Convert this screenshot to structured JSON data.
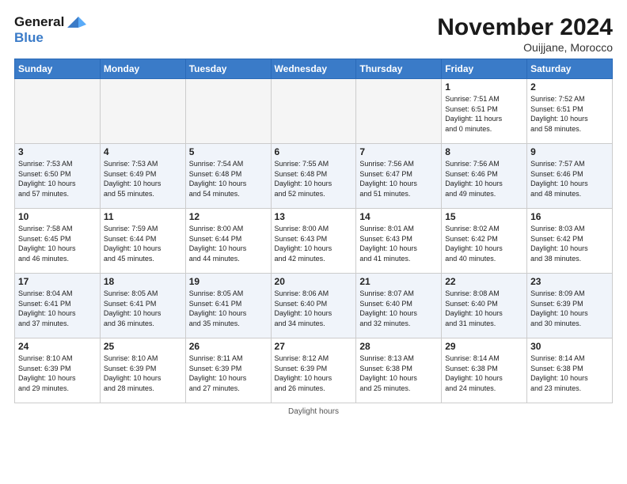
{
  "logo": {
    "line1": "General",
    "line2": "Blue"
  },
  "title": "November 2024",
  "subtitle": "Ouijjane, Morocco",
  "days_header": [
    "Sunday",
    "Monday",
    "Tuesday",
    "Wednesday",
    "Thursday",
    "Friday",
    "Saturday"
  ],
  "footer": "Daylight hours",
  "weeks": [
    [
      {
        "num": "",
        "info": ""
      },
      {
        "num": "",
        "info": ""
      },
      {
        "num": "",
        "info": ""
      },
      {
        "num": "",
        "info": ""
      },
      {
        "num": "",
        "info": ""
      },
      {
        "num": "1",
        "info": "Sunrise: 7:51 AM\nSunset: 6:51 PM\nDaylight: 11 hours\nand 0 minutes."
      },
      {
        "num": "2",
        "info": "Sunrise: 7:52 AM\nSunset: 6:51 PM\nDaylight: 10 hours\nand 58 minutes."
      }
    ],
    [
      {
        "num": "3",
        "info": "Sunrise: 7:53 AM\nSunset: 6:50 PM\nDaylight: 10 hours\nand 57 minutes."
      },
      {
        "num": "4",
        "info": "Sunrise: 7:53 AM\nSunset: 6:49 PM\nDaylight: 10 hours\nand 55 minutes."
      },
      {
        "num": "5",
        "info": "Sunrise: 7:54 AM\nSunset: 6:48 PM\nDaylight: 10 hours\nand 54 minutes."
      },
      {
        "num": "6",
        "info": "Sunrise: 7:55 AM\nSunset: 6:48 PM\nDaylight: 10 hours\nand 52 minutes."
      },
      {
        "num": "7",
        "info": "Sunrise: 7:56 AM\nSunset: 6:47 PM\nDaylight: 10 hours\nand 51 minutes."
      },
      {
        "num": "8",
        "info": "Sunrise: 7:56 AM\nSunset: 6:46 PM\nDaylight: 10 hours\nand 49 minutes."
      },
      {
        "num": "9",
        "info": "Sunrise: 7:57 AM\nSunset: 6:46 PM\nDaylight: 10 hours\nand 48 minutes."
      }
    ],
    [
      {
        "num": "10",
        "info": "Sunrise: 7:58 AM\nSunset: 6:45 PM\nDaylight: 10 hours\nand 46 minutes."
      },
      {
        "num": "11",
        "info": "Sunrise: 7:59 AM\nSunset: 6:44 PM\nDaylight: 10 hours\nand 45 minutes."
      },
      {
        "num": "12",
        "info": "Sunrise: 8:00 AM\nSunset: 6:44 PM\nDaylight: 10 hours\nand 44 minutes."
      },
      {
        "num": "13",
        "info": "Sunrise: 8:00 AM\nSunset: 6:43 PM\nDaylight: 10 hours\nand 42 minutes."
      },
      {
        "num": "14",
        "info": "Sunrise: 8:01 AM\nSunset: 6:43 PM\nDaylight: 10 hours\nand 41 minutes."
      },
      {
        "num": "15",
        "info": "Sunrise: 8:02 AM\nSunset: 6:42 PM\nDaylight: 10 hours\nand 40 minutes."
      },
      {
        "num": "16",
        "info": "Sunrise: 8:03 AM\nSunset: 6:42 PM\nDaylight: 10 hours\nand 38 minutes."
      }
    ],
    [
      {
        "num": "17",
        "info": "Sunrise: 8:04 AM\nSunset: 6:41 PM\nDaylight: 10 hours\nand 37 minutes."
      },
      {
        "num": "18",
        "info": "Sunrise: 8:05 AM\nSunset: 6:41 PM\nDaylight: 10 hours\nand 36 minutes."
      },
      {
        "num": "19",
        "info": "Sunrise: 8:05 AM\nSunset: 6:41 PM\nDaylight: 10 hours\nand 35 minutes."
      },
      {
        "num": "20",
        "info": "Sunrise: 8:06 AM\nSunset: 6:40 PM\nDaylight: 10 hours\nand 34 minutes."
      },
      {
        "num": "21",
        "info": "Sunrise: 8:07 AM\nSunset: 6:40 PM\nDaylight: 10 hours\nand 32 minutes."
      },
      {
        "num": "22",
        "info": "Sunrise: 8:08 AM\nSunset: 6:40 PM\nDaylight: 10 hours\nand 31 minutes."
      },
      {
        "num": "23",
        "info": "Sunrise: 8:09 AM\nSunset: 6:39 PM\nDaylight: 10 hours\nand 30 minutes."
      }
    ],
    [
      {
        "num": "24",
        "info": "Sunrise: 8:10 AM\nSunset: 6:39 PM\nDaylight: 10 hours\nand 29 minutes."
      },
      {
        "num": "25",
        "info": "Sunrise: 8:10 AM\nSunset: 6:39 PM\nDaylight: 10 hours\nand 28 minutes."
      },
      {
        "num": "26",
        "info": "Sunrise: 8:11 AM\nSunset: 6:39 PM\nDaylight: 10 hours\nand 27 minutes."
      },
      {
        "num": "27",
        "info": "Sunrise: 8:12 AM\nSunset: 6:39 PM\nDaylight: 10 hours\nand 26 minutes."
      },
      {
        "num": "28",
        "info": "Sunrise: 8:13 AM\nSunset: 6:38 PM\nDaylight: 10 hours\nand 25 minutes."
      },
      {
        "num": "29",
        "info": "Sunrise: 8:14 AM\nSunset: 6:38 PM\nDaylight: 10 hours\nand 24 minutes."
      },
      {
        "num": "30",
        "info": "Sunrise: 8:14 AM\nSunset: 6:38 PM\nDaylight: 10 hours\nand 23 minutes."
      }
    ]
  ]
}
